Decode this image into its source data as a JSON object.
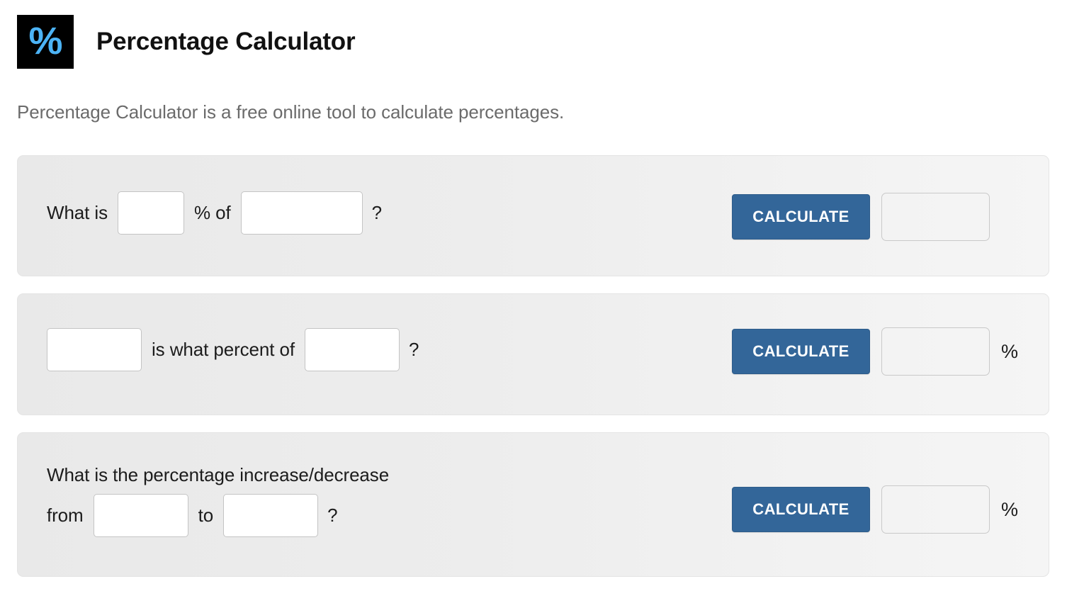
{
  "header": {
    "logo_glyph": "%",
    "logo_bg_color": "#000000",
    "logo_glyph_color": "#4cb3f5",
    "title": "Percentage Calculator"
  },
  "tagline": "Percentage Calculator is a free online tool to calculate percentages.",
  "theme": {
    "button_color": "#336699",
    "panel_bg_start": "#e9e9e9",
    "panel_bg_end": "#f5f5f5",
    "text_color": "#1c1c1c",
    "tagline_color": "#6b6b6b"
  },
  "calculators": [
    {
      "id": "percent-of",
      "label_1": "What is",
      "input_1_value": "",
      "input_1_placeholder": "",
      "label_2": "% of",
      "input_2_value": "",
      "input_2_placeholder": "",
      "label_3": "?",
      "button_label": "CALCULATE",
      "result_value": "",
      "result_placeholder": "",
      "result_suffix": ""
    },
    {
      "id": "what-percent-of",
      "input_1_value": "",
      "input_1_placeholder": "",
      "label_1": "is what percent of",
      "input_2_value": "",
      "input_2_placeholder": "",
      "label_2": "?",
      "button_label": "CALCULATE",
      "result_value": "",
      "result_placeholder": "",
      "result_suffix": "%"
    },
    {
      "id": "increase-decrease",
      "line_1": "What is the percentage increase/decrease",
      "label_from": "from",
      "input_1_value": "",
      "input_1_placeholder": "",
      "label_to": "to",
      "input_2_value": "",
      "input_2_placeholder": "",
      "label_end": "?",
      "button_label": "CALCULATE",
      "result_value": "",
      "result_placeholder": "",
      "result_suffix": "%"
    }
  ]
}
